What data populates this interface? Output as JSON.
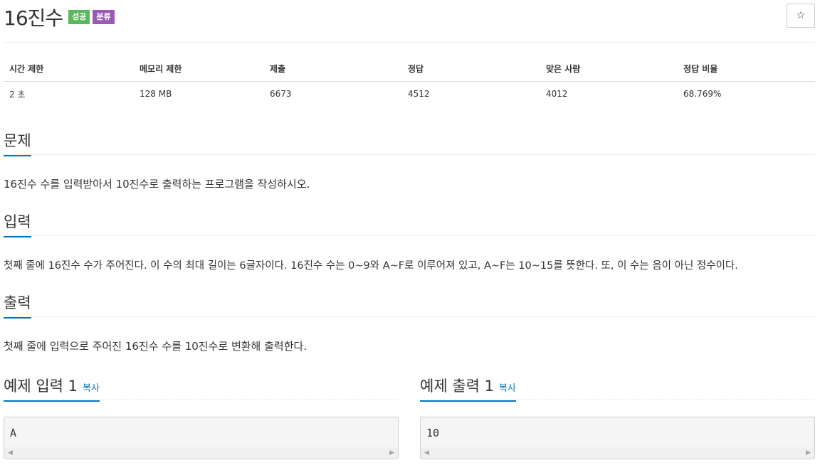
{
  "problem": {
    "title": "16진수",
    "badges": {
      "success": "성공",
      "category": "분류"
    },
    "star_icon": "☆"
  },
  "info_table": {
    "headers": [
      "시간 제한",
      "메모리 제한",
      "제출",
      "정답",
      "맞은 사람",
      "정답 비율"
    ],
    "values": [
      "2 초",
      "128 MB",
      "6673",
      "4512",
      "4012",
      "68.769%"
    ]
  },
  "sections": {
    "problem": {
      "title": "문제",
      "text": "16진수 수를 입력받아서 10진수로 출력하는 프로그램을 작성하시오."
    },
    "input": {
      "title": "입력",
      "text": "첫째 줄에 16진수 수가 주어진다. 이 수의 최대 길이는 6글자이다. 16진수 수는 0~9와 A~F로 이루어져 있고, A~F는 10~15를 뜻한다. 또, 이 수는 음이 아닌 정수이다."
    },
    "output": {
      "title": "출력",
      "text": "첫째 줄에 입력으로 주어진 16진수 수를 10진수로 변환해 출력한다."
    }
  },
  "samples": {
    "input": {
      "title": "예제 입력 1",
      "copy": "복사",
      "content": "A"
    },
    "output": {
      "title": "예제 출력 1",
      "copy": "복사",
      "content": "10"
    }
  },
  "colors": {
    "accent": "#0076c0",
    "success": "#5cb85c",
    "category": "#9b59b6"
  }
}
